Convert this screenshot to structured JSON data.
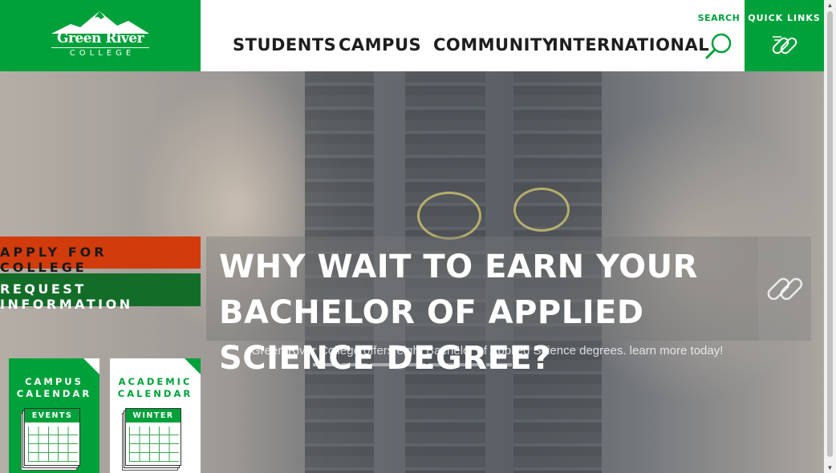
{
  "header": {
    "logo": {
      "name": "Green River",
      "sub": "COLLEGE"
    },
    "nav": [
      {
        "label": "Students"
      },
      {
        "label": "Campus"
      },
      {
        "label": "Community"
      },
      {
        "label": "International"
      }
    ],
    "search": {
      "label": "Search",
      "icon": "search-icon"
    },
    "quick_links": {
      "label": "Quick Links",
      "icon": "link-icon"
    }
  },
  "side_buttons": {
    "apply": "Apply for College",
    "request": "Request Information"
  },
  "carousel": {
    "headline": "Why wait to earn your Bachelor of Applied Science degree?",
    "subtext": "Green River College offers eight Bachelor of Applied Science degrees. learn more today!",
    "link_icon": "link-icon",
    "slide_count": 7,
    "active_slide": 1
  },
  "calendars": [
    {
      "title_line1": "Campus",
      "title_line2": "Calendar",
      "pad_label": "Events"
    },
    {
      "title_line1": "Academic",
      "title_line2": "Calendar",
      "pad_label": "Winter"
    }
  ],
  "colors": {
    "brand_green": "#00a13a",
    "dark_green": "#136d29",
    "apply_orange": "#d23b0c"
  }
}
